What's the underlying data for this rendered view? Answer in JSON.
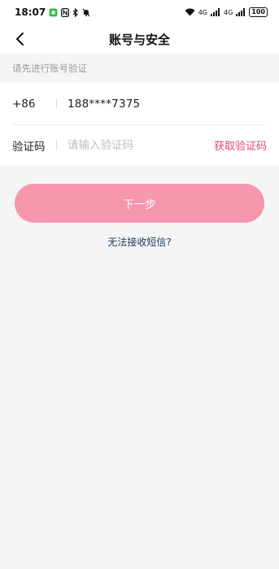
{
  "status_bar": {
    "time": "18:07",
    "network_1": "4G",
    "network_2": "4G",
    "battery": "100"
  },
  "header": {
    "title": "账号与安全",
    "back_icon": "chevron-left-icon"
  },
  "hint": "请先进行账号验证",
  "phone_row": {
    "prefix": "+86",
    "number": "188****7375"
  },
  "code_row": {
    "label": "验证码",
    "placeholder": "请输入验证码",
    "value": "",
    "action": "获取验证码"
  },
  "next_button": "下一步",
  "sms_link": "无法接收短信?",
  "colors": {
    "accent": "#e0457b",
    "button": "#f796af",
    "link": "#1d3a63"
  }
}
